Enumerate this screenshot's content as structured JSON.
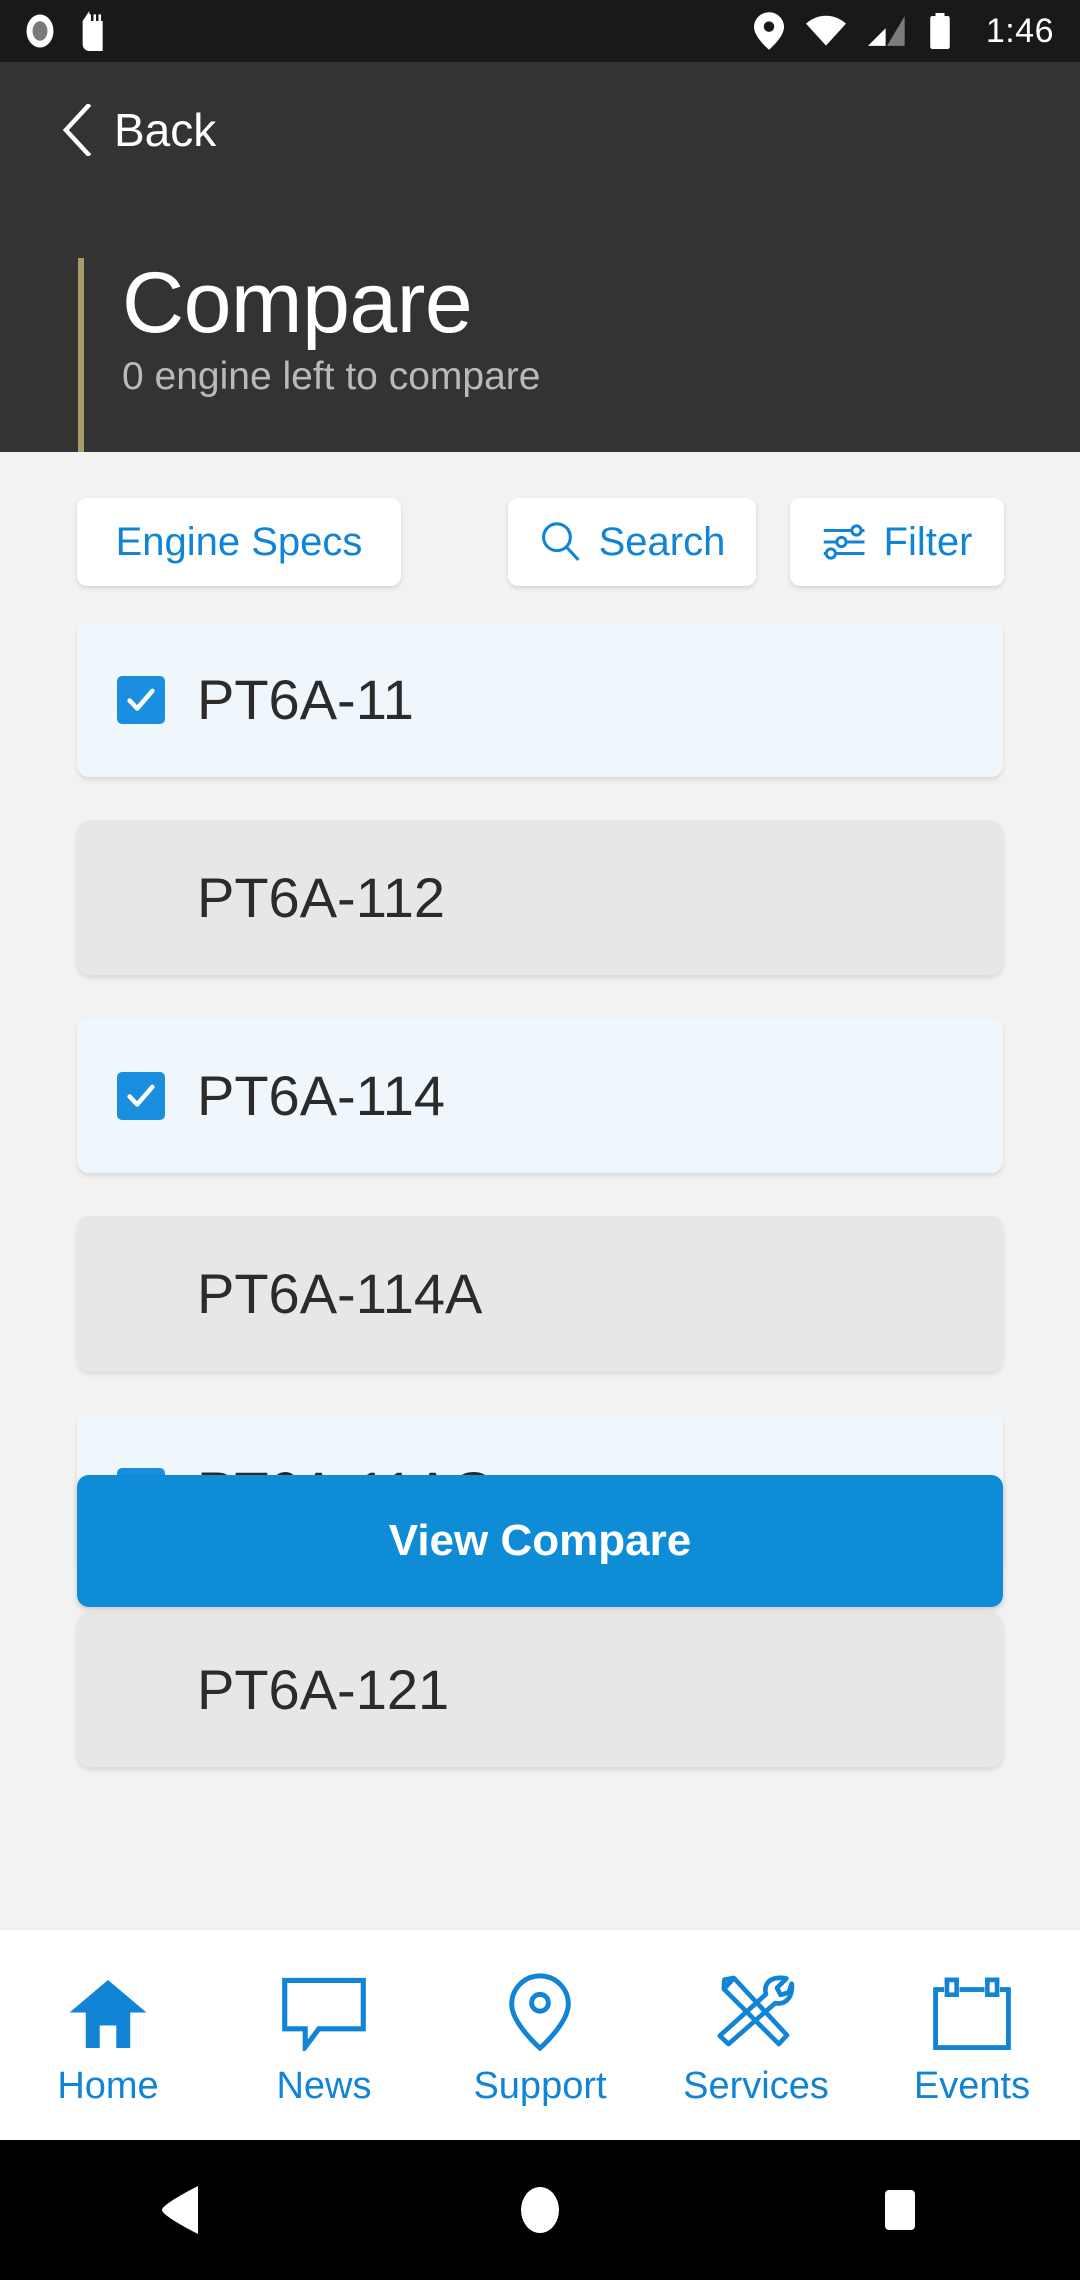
{
  "status_bar": {
    "icons_left": [
      "record-icon",
      "sd-card-icon"
    ],
    "icons_right": [
      "location-icon",
      "wifi-icon",
      "cell-signal-icon",
      "battery-icon"
    ],
    "time": "1:46",
    "background": "#191919"
  },
  "header": {
    "background": "#333333",
    "accent_color": "#a89a69",
    "back_label": "Back",
    "back_icon": "chevron-left-icon",
    "title": "Compare",
    "subtitle": "0 engine left to compare"
  },
  "toolbar": {
    "engine_specs_label": "Engine Specs",
    "search_label": "Search",
    "search_icon": "search-icon",
    "filter_label": "Filter",
    "filter_icon": "filter-sliders-icon",
    "accent_color": "#1284d6"
  },
  "list": {
    "items": [
      {
        "name": "PT6A-11",
        "selected": true
      },
      {
        "name": "PT6A-112",
        "selected": false
      },
      {
        "name": "PT6A-114",
        "selected": true
      },
      {
        "name": "PT6A-114A",
        "selected": false
      },
      {
        "name": "PT6A-11AG",
        "selected": true
      },
      {
        "name": "PT6A-121",
        "selected": false
      }
    ],
    "selected_bg": "#eff6fc",
    "unselected_bg": "#e7e7e7",
    "checkbox_color": "#1a8fe0"
  },
  "primary_action": {
    "label": "View Compare",
    "background": "#0f8cd6",
    "text_color": "#ffffff"
  },
  "bottom_nav": {
    "color": "#1284d6",
    "items": [
      {
        "label": "Home",
        "icon": "home-icon"
      },
      {
        "label": "News",
        "icon": "speech-bubble-icon"
      },
      {
        "label": "Support",
        "icon": "map-pin-icon"
      },
      {
        "label": "Services",
        "icon": "tools-icon"
      },
      {
        "label": "Events",
        "icon": "calendar-icon"
      }
    ]
  },
  "android_nav": {
    "background": "#000000",
    "buttons": [
      "back-triangle-icon",
      "home-circle-icon",
      "recents-square-icon"
    ]
  }
}
